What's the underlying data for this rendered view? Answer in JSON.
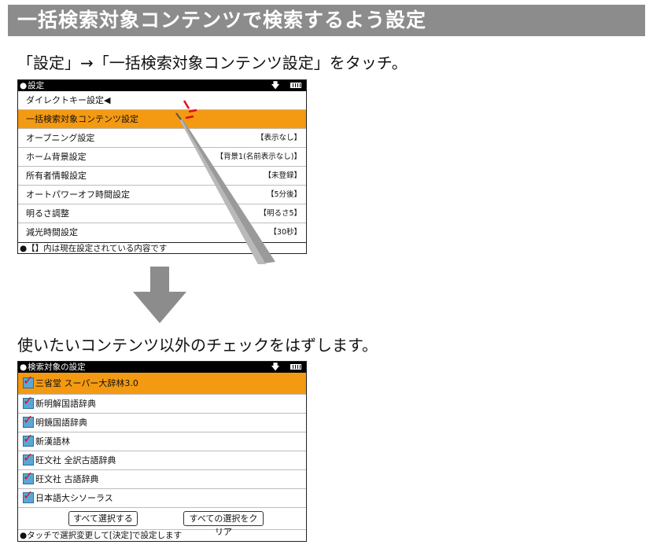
{
  "title": "一括検索対象コンテンツで検索するよう設定",
  "step1_instruction": "「設定」→「一括検索対象コンテンツ設定」をタッチ。",
  "step2_instruction": "使いたいコンテンツ以外のチェックをはずします。",
  "screen1": {
    "header_title": "設定",
    "header_dot": "●",
    "rows": [
      {
        "label": "ダイレクトキー設定◀",
        "value": ""
      },
      {
        "label": "一括検索対象コンテンツ設定",
        "value": ""
      },
      {
        "label": "オープニング設定",
        "value": "【表示なし】"
      },
      {
        "label": "ホーム背景設定",
        "value": "【背景1(名前表示なし)】"
      },
      {
        "label": "所有者情報設定",
        "value": "【未登録】"
      },
      {
        "label": "オートパワーオフ時間設定",
        "value": "【5分後】"
      },
      {
        "label": "明るさ調整",
        "value": "【明るさ5】"
      },
      {
        "label": "減光時間設定",
        "value": "【30秒】"
      }
    ],
    "selected_index": 1,
    "footer": "●【】内は現在設定されている内容です"
  },
  "screen2": {
    "header_title": "検索対象の設定",
    "header_dot": "●",
    "items": [
      {
        "label": "三省堂 スーパー大辞林3.0",
        "checked": true
      },
      {
        "label": "新明解国語辞典",
        "checked": true
      },
      {
        "label": "明鏡国語辞典",
        "checked": true
      },
      {
        "label": "新漢語林",
        "checked": true
      },
      {
        "label": "旺文社 全訳古語辞典",
        "checked": true
      },
      {
        "label": "旺文社 古語辞典",
        "checked": true
      },
      {
        "label": "日本語大シソーラス",
        "checked": true
      }
    ],
    "selected_index": 0,
    "select_all_label": "すべて選択する",
    "clear_all_label": "すべての選択をクリア",
    "footer": "●タッチで選択変更して[決定]で設定します"
  },
  "icons": {
    "download": "download-arrow-icon",
    "battery": "battery-icon",
    "check": "checkmark-icon",
    "big_arrow": "down-arrow-icon",
    "stylus": "stylus-icon"
  },
  "colors": {
    "title_bg": "#8c8c8c",
    "selected_bg": "#f49a12",
    "check_mark": "#e0101a",
    "checkbox": "#5aa6d6"
  }
}
